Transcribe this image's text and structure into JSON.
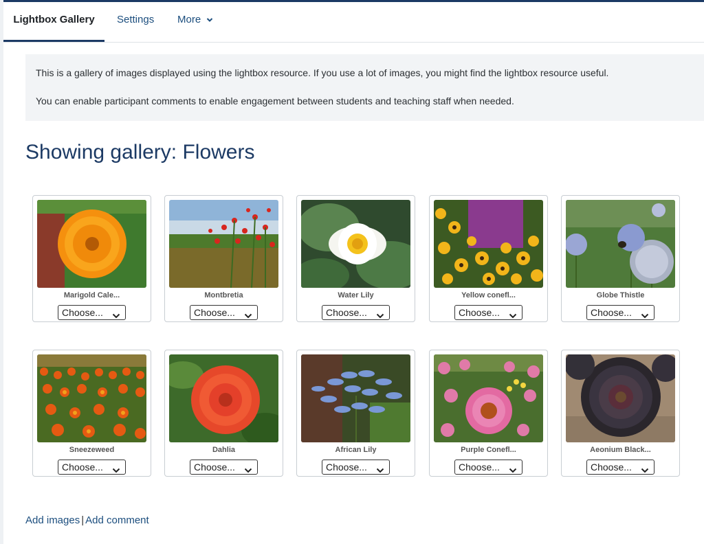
{
  "tabs": [
    {
      "label": "Lightbox Gallery",
      "active": true
    },
    {
      "label": "Settings",
      "active": false
    },
    {
      "label": "More",
      "active": false
    }
  ],
  "intro": {
    "line1": "This is a gallery of images displayed using the lightbox resource.  If you use a lot of images, you might find the lightbox resource useful.",
    "line2": "You can enable participant comments to enable engagement between students and teaching staff when needed."
  },
  "gallery": {
    "heading": "Showing gallery: Flowers",
    "select_placeholder": "Choose...",
    "images": [
      {
        "caption": "Marigold Cale...",
        "icon": "marigold-photo"
      },
      {
        "caption": "Montbretia",
        "icon": "montbretia-photo"
      },
      {
        "caption": "Water Lily",
        "icon": "water-lily-photo"
      },
      {
        "caption": "Yellow conefl...",
        "icon": "yellow-coneflower-photo"
      },
      {
        "caption": "Globe Thistle",
        "icon": "globe-thistle-photo"
      },
      {
        "caption": "Sneezeweed",
        "icon": "sneezeweed-photo"
      },
      {
        "caption": "Dahlia",
        "icon": "dahlia-photo"
      },
      {
        "caption": "African Lily",
        "icon": "african-lily-photo"
      },
      {
        "caption": "Purple Conefl...",
        "icon": "purple-coneflower-photo"
      },
      {
        "caption": "Aeonium Black...",
        "icon": "aeonium-photo"
      }
    ]
  },
  "footer": {
    "add_images": "Add images",
    "separator": "|",
    "add_comment": "Add comment"
  },
  "colors": {
    "brand": "#1c3a64",
    "link": "#1c4e7e",
    "intro_bg": "#f2f4f6"
  }
}
